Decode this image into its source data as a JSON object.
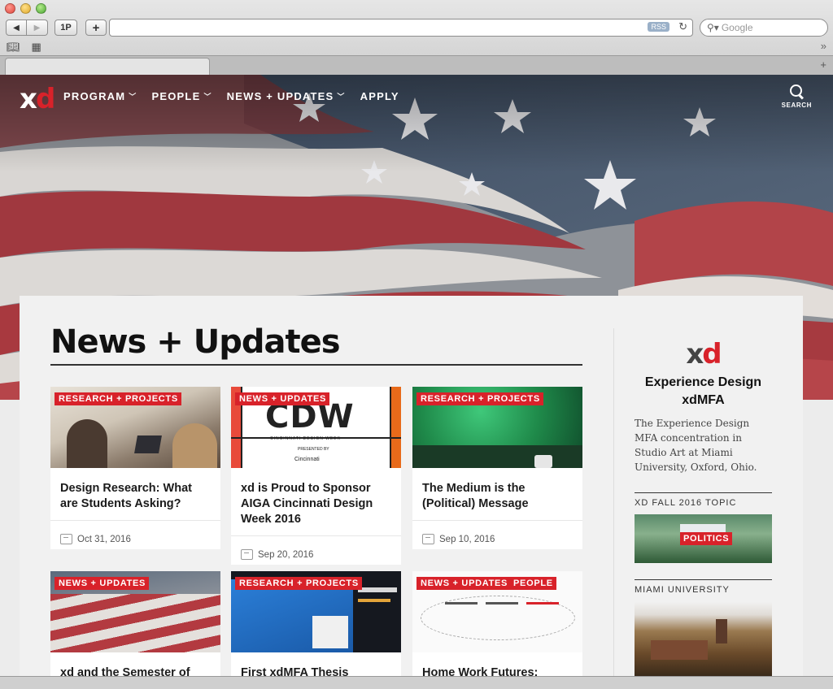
{
  "browser": {
    "back_icon": "back-arrow-icon",
    "forward_icon": "forward-arrow-icon",
    "btn_1p": "1P",
    "btn_plus": "+",
    "rss_label": "RSS",
    "search_placeholder": "Google"
  },
  "site": {
    "logo_x": "x",
    "logo_d": "d",
    "nav": [
      {
        "label": "PROGRAM"
      },
      {
        "label": "PEOPLE"
      },
      {
        "label": "NEWS + UPDATES"
      },
      {
        "label": "APPLY"
      }
    ],
    "search_label": "SEARCH",
    "brand_red": "#d8222a"
  },
  "main": {
    "title": "News + Updates",
    "cards": [
      {
        "tags": [
          "RESEARCH + PROJECTS"
        ],
        "title": "Design Research: What are Students Asking?",
        "date": "Oct 31, 2016"
      },
      {
        "tags": [
          "NEWS + UPDATES"
        ],
        "title": "xd is Proud to Sponsor AIGA Cincinnati Design Week 2016",
        "date": "Sep 20, 2016",
        "img_text": "CDW",
        "img_sub": "CINCINNATI DESIGN WEEK",
        "img_presented": "PRESENTED BY",
        "img_sponsor": "Cincinnati"
      },
      {
        "tags": [
          "RESEARCH + PROJECTS"
        ],
        "title": "The Medium is the (Political) Message",
        "date": "Sep 10, 2016"
      },
      {
        "tags": [
          "NEWS + UPDATES"
        ],
        "title": "xd and the Semester of",
        "date": ""
      },
      {
        "tags": [
          "RESEARCH + PROJECTS"
        ],
        "title": "First xdMFA Thesis",
        "date": ""
      },
      {
        "tags": [
          "NEWS + UPDATES",
          "PEOPLE"
        ],
        "title": "Home Work Futures:",
        "date": ""
      }
    ]
  },
  "sidebar": {
    "title": "Experience Design xdMFA",
    "description": "The Experience Design MFA concentration in Studio Art at Miami University, Oxford, Ohio.",
    "topic_heading": "XD FALL 2016 TOPIC",
    "topic_tag": "POLITICS",
    "university_heading": "MIAMI UNIVERSITY"
  }
}
